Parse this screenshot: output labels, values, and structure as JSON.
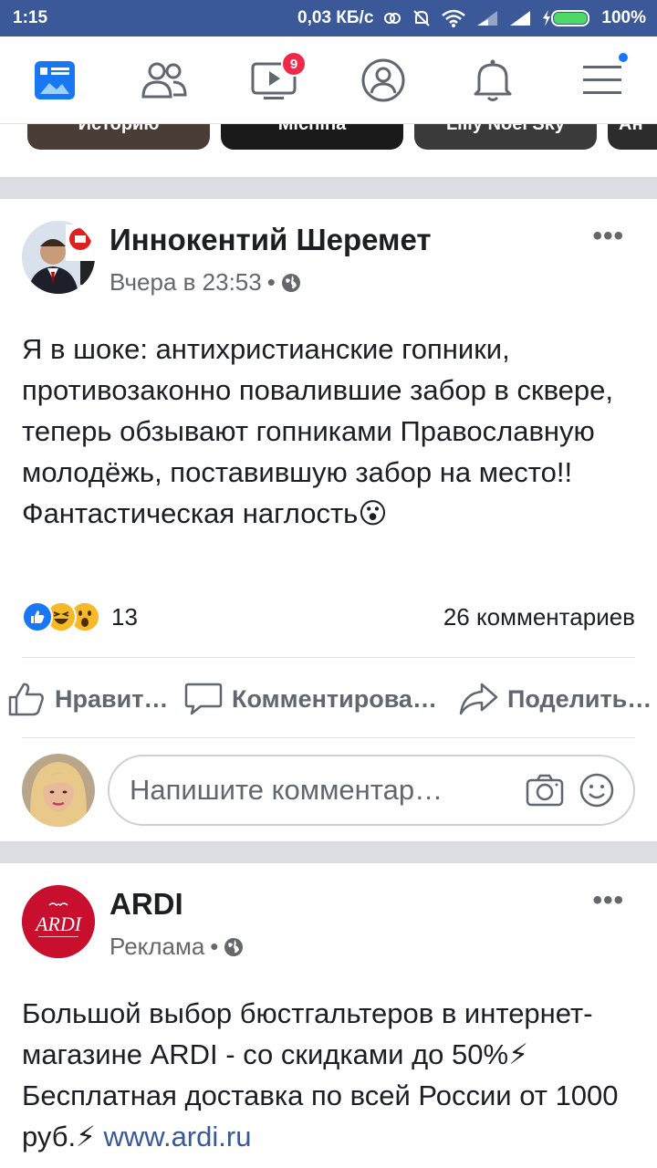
{
  "status": {
    "time": "1:15",
    "network_speed": "0,03 КБ/с",
    "battery": "100%"
  },
  "nav": {
    "video_badge": "9"
  },
  "stories": [
    "Историю",
    "Michina",
    "Lilly Noel Sky",
    "Ан"
  ],
  "post1": {
    "author": "Иннокентий Шеремет",
    "time": "Вчера в 23:53",
    "text": "Я в шоке: антихристианские гопники, противозаконно повалившие забор в сквере, теперь обзывают гопниками Православную молодёжь, поставившую забор на место!! Фантастическая наглость😮",
    "reactions_count": "13",
    "comments_count": "26 комментариев",
    "like_label": "Нравит…",
    "comment_label": "Комментирова…",
    "share_label": "Поделить…",
    "comment_placeholder": "Напишите комментар…"
  },
  "post2": {
    "author": "ARDI",
    "meta": "Реклама",
    "text_part1": "Большой выбор бюстгальтеров в интернет-магазине ARDI - со скидками до 50%⚡ Бесплатная доставка по всей России от 1000 руб.⚡ ",
    "link": "www.ardi.ru",
    "logo_text": "ARDI"
  },
  "colors": {
    "brand": "#3b5998",
    "badge": "#f02849",
    "link": "#385898"
  }
}
